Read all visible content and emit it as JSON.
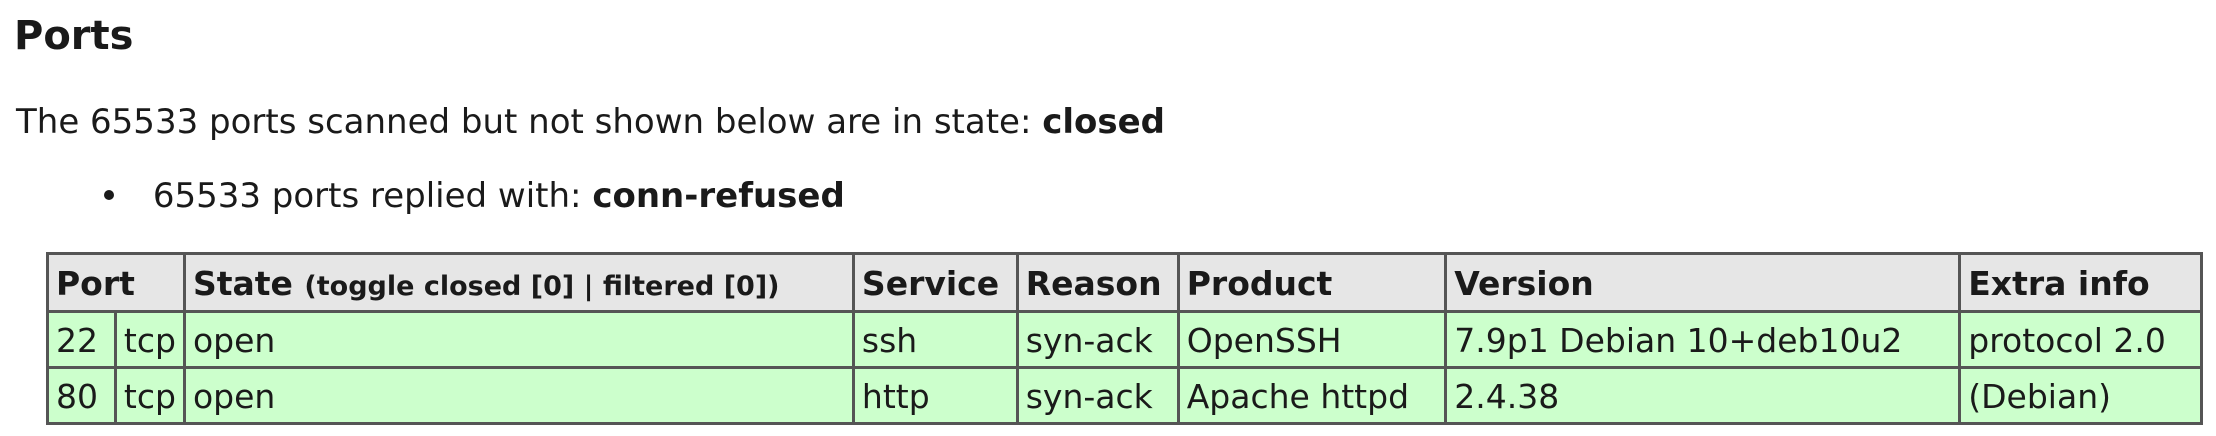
{
  "section": {
    "title": "Ports"
  },
  "summary": {
    "prefix": "The 65533 ports scanned but not shown below are in state:",
    "state": "closed"
  },
  "reasons": [
    {
      "prefix": "65533 ports replied with:",
      "reason": "conn-refused"
    }
  ],
  "table": {
    "headers": {
      "port": "Port",
      "state": "State",
      "toggle": "(toggle closed [0] | filtered [0])",
      "service": "Service",
      "reason": "Reason",
      "product": "Product",
      "version": "Version",
      "extra": "Extra info"
    },
    "rows": [
      {
        "port": "22",
        "protocol": "tcp",
        "state": "open",
        "service": "ssh",
        "reason": "syn-ack",
        "product": "OpenSSH",
        "version": "7.9p1 Debian 10+deb10u2",
        "extra": "protocol 2.0"
      },
      {
        "port": "80",
        "protocol": "tcp",
        "state": "open",
        "service": "http",
        "reason": "syn-ack",
        "product": "Apache httpd",
        "version": "2.4.38",
        "extra": "(Debian)"
      }
    ]
  },
  "colors": {
    "header_background": "#e6e6e6",
    "open_row_background": "#ccffcc",
    "border": "#555555",
    "text": "#1a1a1a"
  }
}
